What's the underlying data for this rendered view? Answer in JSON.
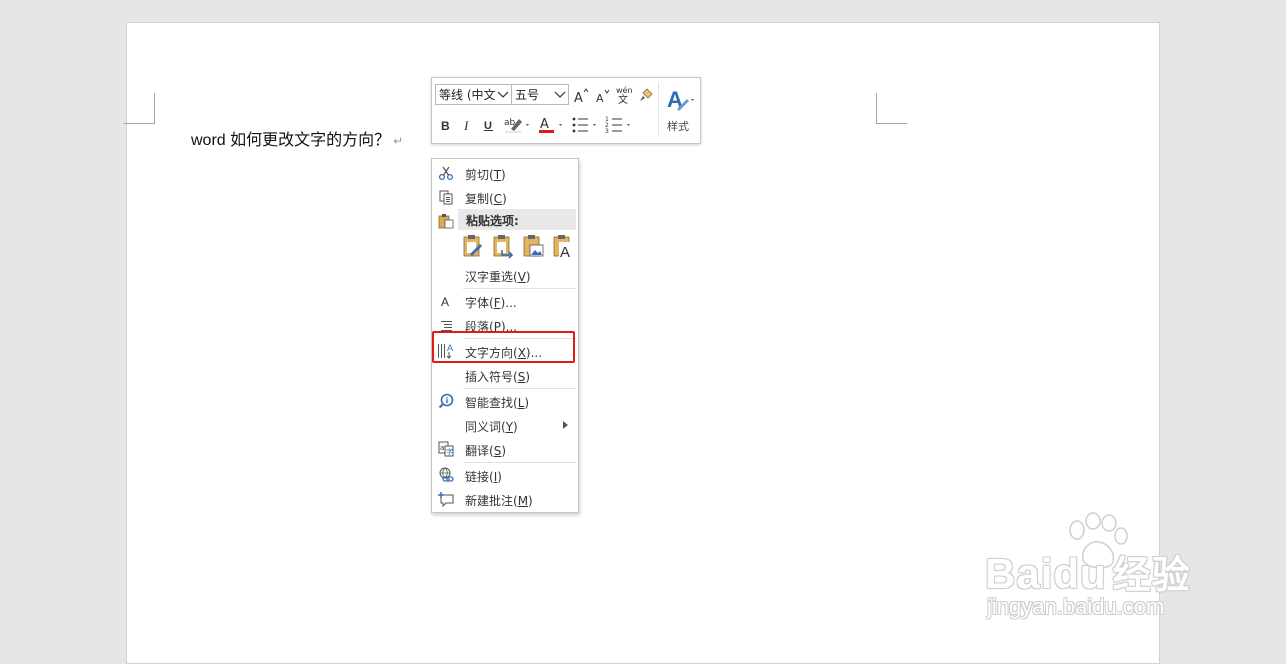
{
  "document": {
    "line_text": "word 如何更改文字的方向？",
    "para_mark": "↵"
  },
  "mini_toolbar": {
    "font_name": "等线 (中文",
    "font_size": "五号",
    "styles_label": "样式",
    "font_color": "#e11b14"
  },
  "context_menu": {
    "cut": {
      "text": "剪切(",
      "key": "T",
      "end": ")"
    },
    "copy": {
      "text": "复制(",
      "key": "C",
      "end": ")"
    },
    "paste_options_header": "粘贴选项:",
    "reconvert": {
      "text": "汉字重选(",
      "key": "V",
      "end": ")"
    },
    "font": {
      "text": "字体(",
      "key": "F",
      "end": ")..."
    },
    "paragraph": {
      "text": "段落(",
      "key": "P",
      "end": ")..."
    },
    "text_direction": {
      "text": "文字方向(",
      "key": "X",
      "end": ")..."
    },
    "insert_symbol": {
      "text": "插入符号(",
      "key": "S",
      "end": ")"
    },
    "smart_lookup": {
      "text": "智能查找(",
      "key": "L",
      "end": ")"
    },
    "synonyms": {
      "text": "同义词(",
      "key": "Y",
      "end": ")"
    },
    "translate": {
      "text": "翻译(",
      "key": "S",
      "end": ")"
    },
    "link": {
      "text": "链接(",
      "key": "I",
      "end": ")"
    },
    "new_comment": {
      "text": "新建批注(",
      "key": "M",
      "end": ")"
    }
  },
  "highlight_color": "#e11b14",
  "watermark": {
    "brand": "Baidu",
    "brand_cn": "经验",
    "url": "jingyan.baidu.com"
  }
}
